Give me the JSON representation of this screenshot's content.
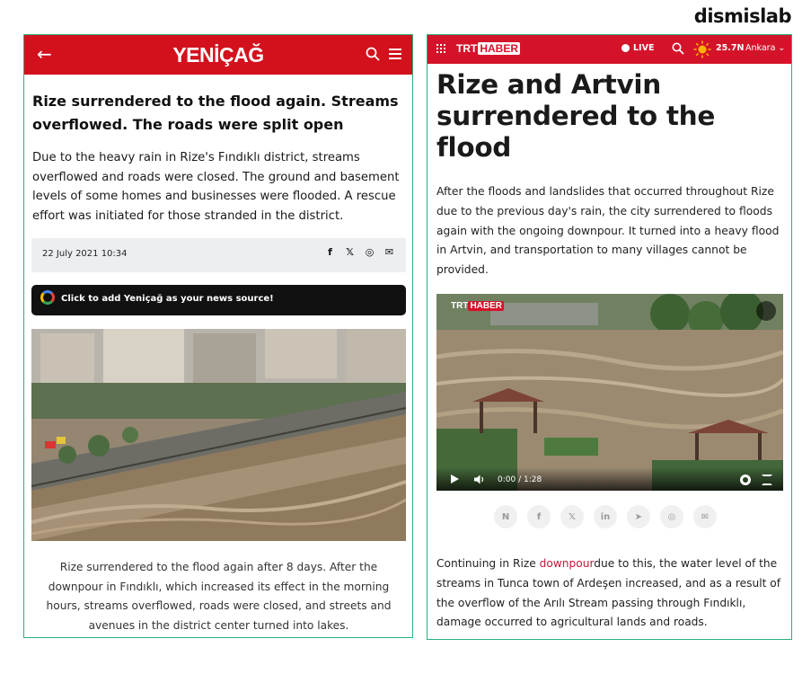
{
  "brand": "dismislab",
  "yenicag": {
    "back_arrow": "←",
    "logo": "YENİÇAĞ",
    "title": "Rize surrendered to the flood again. Streams overflowed. The roads were split open",
    "lead": "Due to the heavy rain in Rize's Fındıklı district, streams overflowed and roads were closed. The ground and basement levels of some homes and businesses were flooded. A rescue effort was initiated for those stranded in the district.",
    "date": "22 July 2021 10:34",
    "share_icons": [
      "facebook-icon",
      "x-icon",
      "whatsapp-icon",
      "mail-icon"
    ],
    "share_glyphs": [
      "f",
      "𝕏",
      "◎",
      "✉"
    ],
    "google_button": "Click to add Yeniçağ as your news source!",
    "caption": "Rize surrendered to the flood again after 8 days. After the downpour in Fındıklı, which increased its effect in the morning hours, streams overflowed, roads were closed, and streets and avenues in the district center turned into lakes."
  },
  "trt": {
    "logo_trt": "TRT",
    "logo_haber": "HABER",
    "live": "LIVE",
    "temperature": "25.7N",
    "city": "Ankara ⌄",
    "title": "Rize and Artvin surrendered to the flood",
    "lead": "After the floods and landslides that occurred throughout Rize due to the previous day's rain, the city surrendered to floods again with the ongoing downpour. It turned into a heavy flood in Artvin, and transportation to many villages cannot be provided.",
    "video_time": "0:00 / 1:28",
    "share_icons": [
      "news-icon",
      "facebook-icon",
      "x-icon",
      "linkedin-icon",
      "telegram-icon",
      "whatsapp-icon",
      "mail-icon"
    ],
    "share_glyphs": [
      "N",
      "f",
      "𝕏",
      "in",
      "➤",
      "◎",
      "✉"
    ],
    "body_before": "Continuing in Rize ",
    "body_link": "downpour",
    "body_after": "due to this, the water level of the streams in Tunca town of Ardeşen increased, and as a result of the overflow of the Arılı Stream passing through Fındıklı, damage occurred to agricultural lands and roads."
  },
  "colors": {
    "yenicag_red": "#d3111d",
    "trt_red": "#d4132a",
    "panel_border": "#2bb07a"
  }
}
